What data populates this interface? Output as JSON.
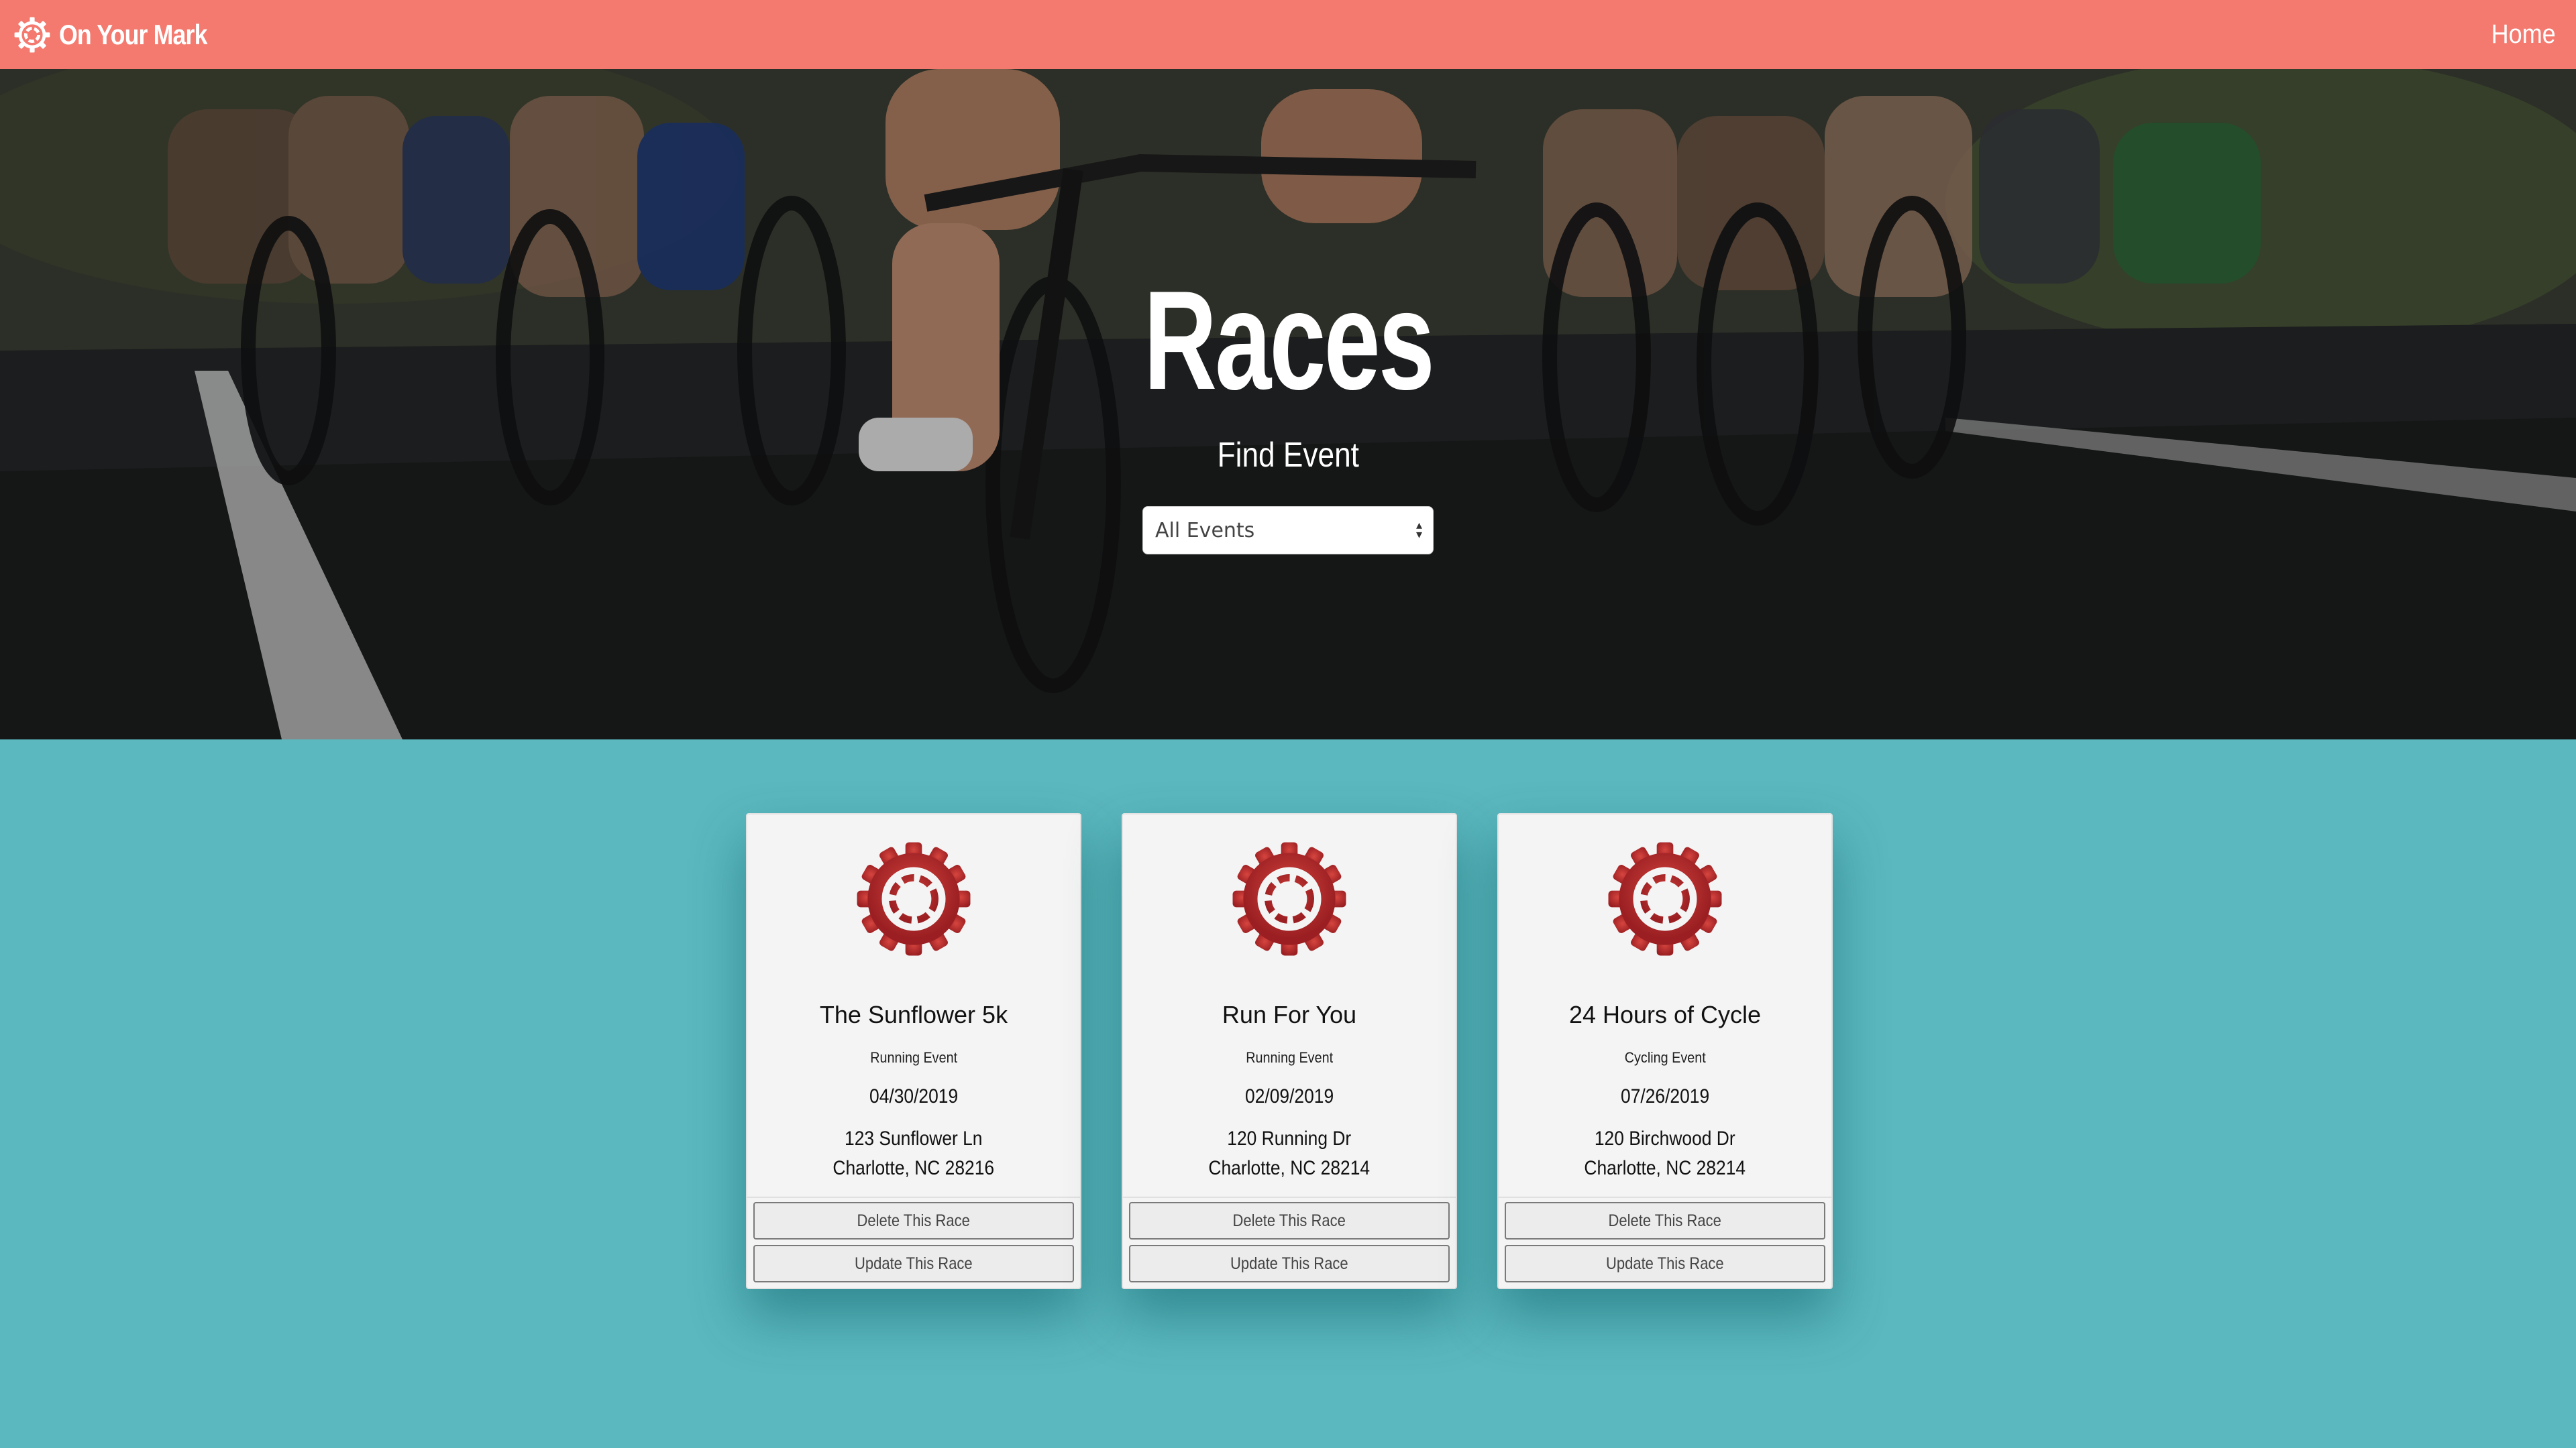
{
  "navbar": {
    "brand": "On Your Mark",
    "home_link": "Home"
  },
  "hero": {
    "title": "Races",
    "subtitle": "Find Event",
    "event_filter": {
      "selected": "All Events"
    }
  },
  "races": [
    {
      "name": "The Sunflower 5k",
      "type": "Running Event",
      "date": "04/30/2019",
      "address_line1": "123 Sunflower Ln",
      "address_line2": "Charlotte, NC 28216",
      "delete_label": "Delete This Race",
      "update_label": "Update This Race"
    },
    {
      "name": "Run For You",
      "type": "Running Event",
      "date": "02/09/2019",
      "address_line1": "120 Running Dr",
      "address_line2": "Charlotte, NC 28214",
      "delete_label": "Delete This Race",
      "update_label": "Update This Race"
    },
    {
      "name": "24 Hours of Cycle",
      "type": "Cycling Event",
      "date": "07/26/2019",
      "address_line1": "120 Birchwood Dr",
      "address_line2": "Charlotte, NC 28214",
      "delete_label": "Delete This Race",
      "update_label": "Update This Race"
    }
  ],
  "colors": {
    "navbar_bg": "#f47a6f",
    "page_bg": "#5ab8be",
    "gear_red": "#b8282c"
  },
  "icons": {
    "brand": "gear-icon",
    "card": "gear-icon",
    "select": "sort-arrows-icon"
  }
}
